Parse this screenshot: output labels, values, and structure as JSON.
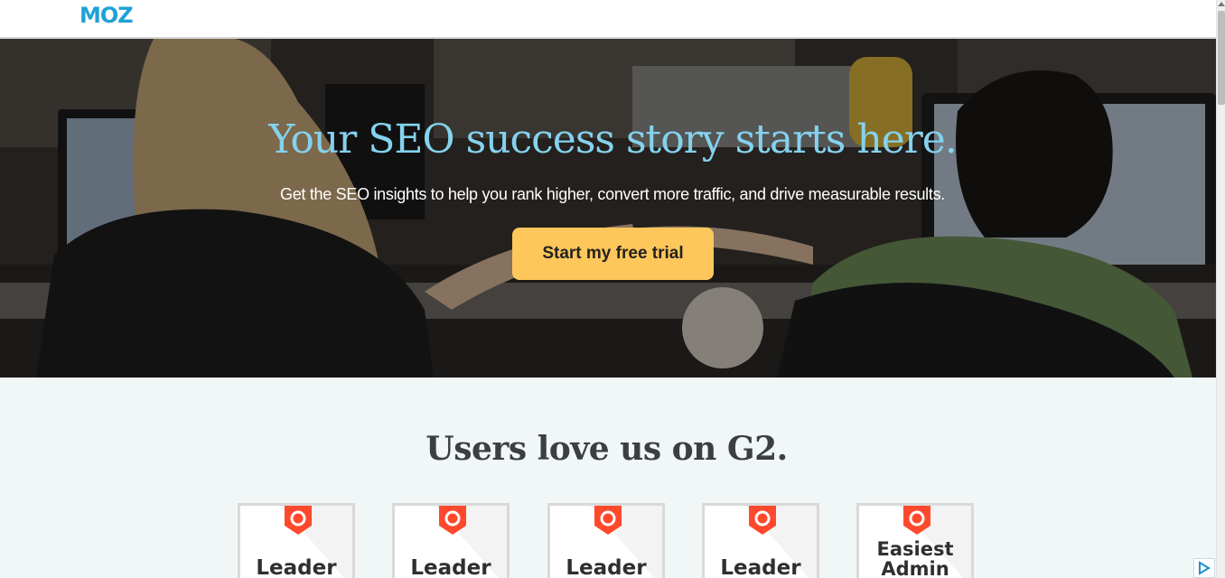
{
  "header": {
    "logo_text": "MOZ"
  },
  "hero": {
    "title": "Your SEO success story starts here.",
    "subtitle": "Get the SEO insights to help you rank higher, convert more traffic, and drive measurable results.",
    "cta_label": "Start my free trial"
  },
  "g2": {
    "title": "Users love us on G2.",
    "badges": [
      {
        "label": "Leader"
      },
      {
        "label": "Leader"
      },
      {
        "label": "Leader"
      },
      {
        "label": "Leader"
      },
      {
        "label_line1": "Easiest",
        "label_line2": "Admin"
      }
    ]
  },
  "colors": {
    "brand": "#1fa1d6",
    "hero_title": "#84d2ee",
    "cta": "#fdc75b",
    "g2_red": "#ff492c",
    "section_bg": "#f1f7f6"
  },
  "icons": {
    "ad": "adchoices-icon",
    "badge_logo": "g2-logo-icon"
  }
}
